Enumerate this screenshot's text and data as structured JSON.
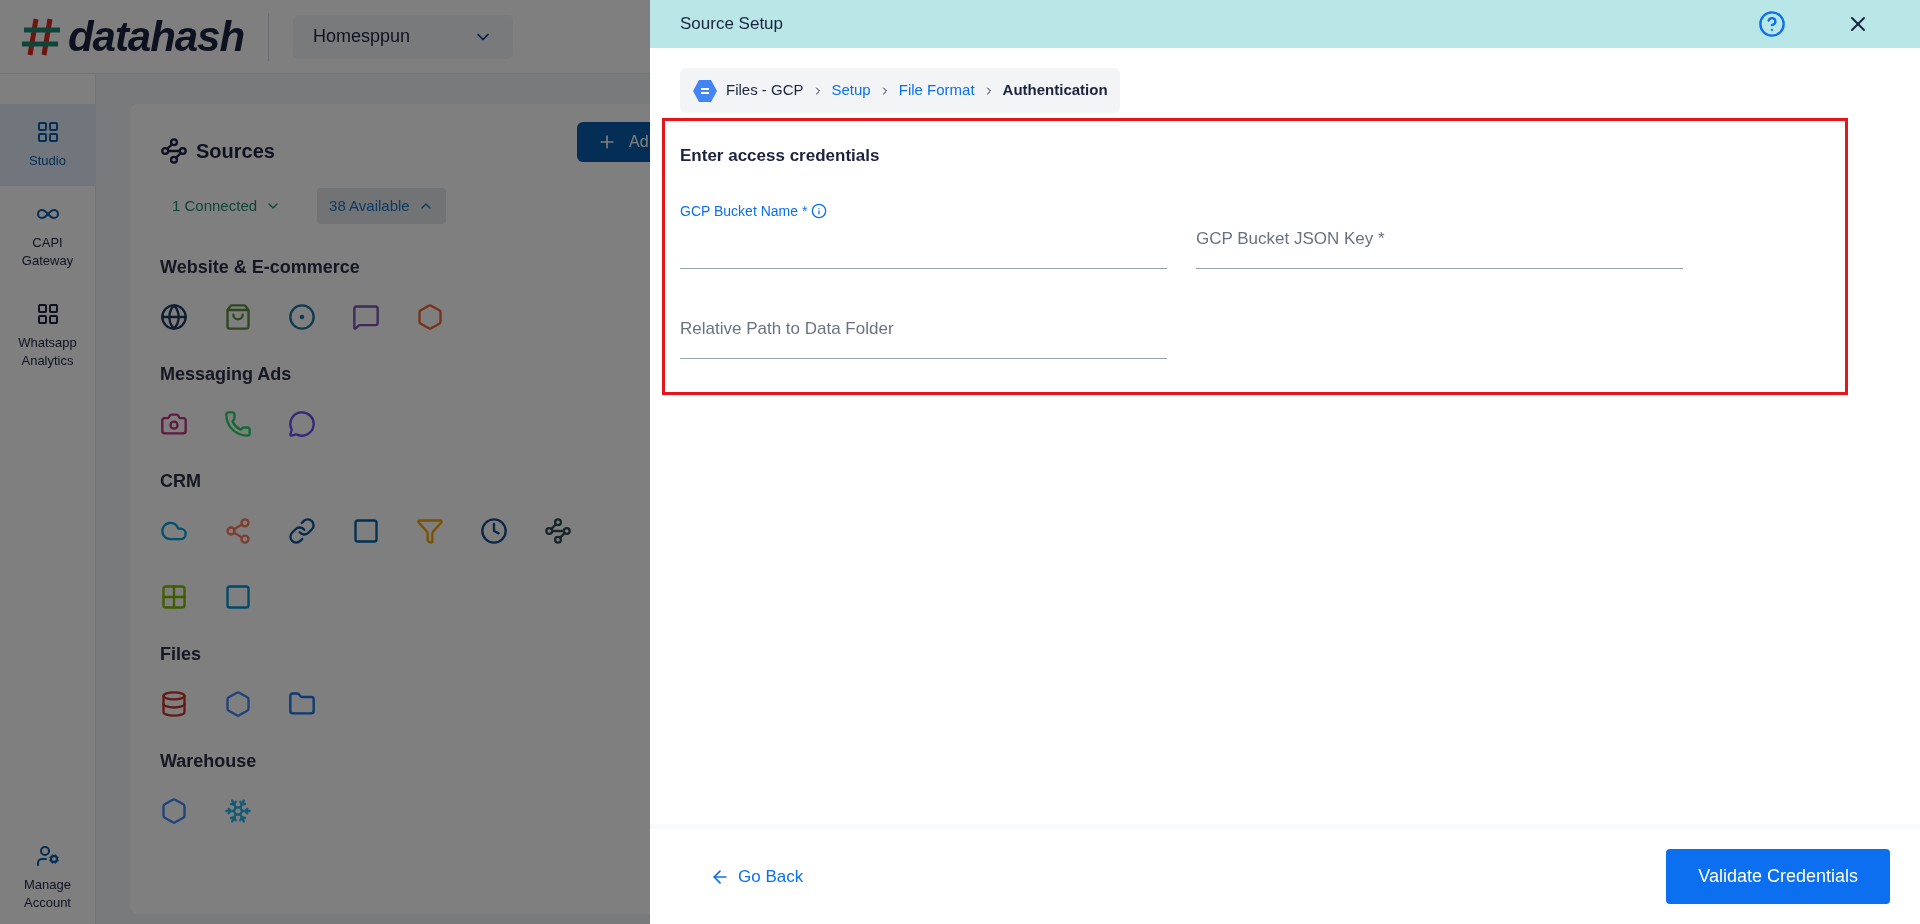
{
  "header": {
    "logo": "datahash",
    "workspace": "Homesppun"
  },
  "sidebar": {
    "items": [
      {
        "label": "Studio",
        "selected": true,
        "kind": "grid"
      },
      {
        "label": "CAPI Gateway",
        "selected": false,
        "kind": "infinity"
      },
      {
        "label": "Whatsapp Analytics",
        "selected": false,
        "kind": "grid"
      }
    ],
    "bottom_item": {
      "label": "Manage Account"
    }
  },
  "sources": {
    "title": "Sources",
    "add_button": "Ad",
    "filters": [
      {
        "label": "1 Connected",
        "selected": false,
        "expanded": false
      },
      {
        "label": "38 Available",
        "selected": true,
        "expanded": true
      }
    ],
    "categories": [
      {
        "title": "Website & E-commerce"
      },
      {
        "title": "Messaging Ads"
      },
      {
        "title": "CRM"
      },
      {
        "title": "Files"
      },
      {
        "title": "Warehouse"
      }
    ]
  },
  "drawer": {
    "title": "Source Setup",
    "breadcrumb": [
      {
        "label": "Files - GCP",
        "link": false
      },
      {
        "label": "Setup",
        "link": true
      },
      {
        "label": "File Format",
        "link": true
      },
      {
        "label": "Authentication",
        "link": false
      }
    ],
    "section_title": "Enter access credentials",
    "fields": [
      {
        "label": "GCP Bucket Name *",
        "focused": true
      },
      {
        "label": "GCP Bucket JSON Key *",
        "focused": false
      },
      {
        "label": "Relative Path to Data Folder",
        "focused": false
      }
    ],
    "back_button": "Go Back",
    "primary_button": "Validate Credentials"
  }
}
